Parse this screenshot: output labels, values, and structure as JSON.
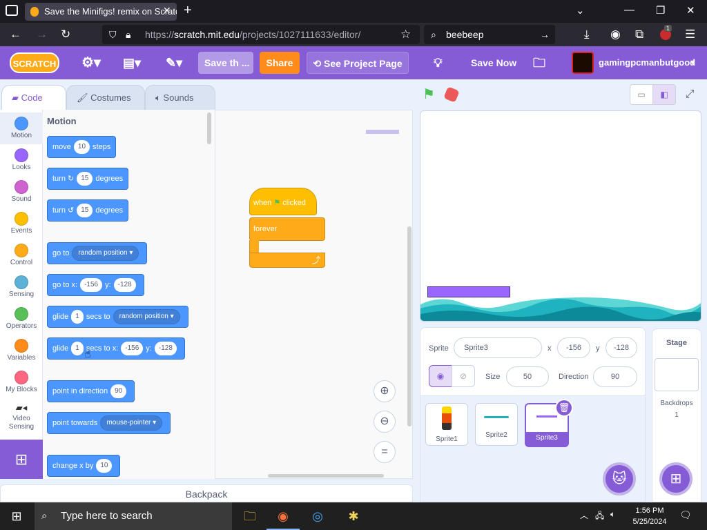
{
  "browser": {
    "tab_title": "Save the Minifigs! remix on Scratch",
    "url_prefix": "https://",
    "url_host": "scratch.mit.edu",
    "url_path": "/projects/1027111633/editor/",
    "search_value": "beebeep",
    "extension_badge": "1"
  },
  "menubar": {
    "logo": "SCRATCH",
    "title_field": "Save th ...",
    "share": "Share",
    "see_project": "See Project Page",
    "save_now": "Save Now",
    "username": "gamingpcmanbutgood",
    "colors": {
      "bar": "#855cd6",
      "share": "#ff8c1a"
    }
  },
  "editor_tabs": {
    "code": "Code",
    "costumes": "Costumes",
    "sounds": "Sounds"
  },
  "categories": [
    {
      "label": "Motion",
      "color": "#4c97ff"
    },
    {
      "label": "Looks",
      "color": "#9966ff"
    },
    {
      "label": "Sound",
      "color": "#cf63cf"
    },
    {
      "label": "Events",
      "color": "#ffbf00"
    },
    {
      "label": "Control",
      "color": "#ffab19"
    },
    {
      "label": "Sensing",
      "color": "#5cb1d6"
    },
    {
      "label": "Operators",
      "color": "#59c059"
    },
    {
      "label": "Variables",
      "color": "#ff8c1a"
    },
    {
      "label": "My Blocks",
      "color": "#ff6680"
    },
    {
      "label": "Video Sensing",
      "color": "#0fbd8c"
    }
  ],
  "palette": {
    "heading": "Motion",
    "move": {
      "a": "move",
      "v": "10",
      "b": "steps"
    },
    "turn_right": {
      "a": "turn",
      "v": "15",
      "b": "degrees"
    },
    "turn_left": {
      "a": "turn",
      "v": "15",
      "b": "degrees"
    },
    "goto": {
      "a": "go to",
      "d": "random position"
    },
    "goto_xy": {
      "a": "go to x:",
      "x": "-156",
      "b": "y:",
      "y": "-128"
    },
    "glide": {
      "a": "glide",
      "v": "1",
      "b": "secs to",
      "d": "random position"
    },
    "glide_xy": {
      "a": "glide",
      "v": "1",
      "b": "secs to x:",
      "x": "-156",
      "c": "y:",
      "y": "-128"
    },
    "point_dir": {
      "a": "point in direction",
      "v": "90"
    },
    "point_towards": {
      "a": "point towards",
      "d": "mouse-pointer"
    },
    "change_x": {
      "a": "change x by",
      "v": "10"
    }
  },
  "script": {
    "when": "when",
    "clicked": "clicked",
    "forever": "forever"
  },
  "backpack": "Backpack",
  "sprite_info": {
    "sprite_label": "Sprite",
    "sprite_name": "Sprite3",
    "x_label": "x",
    "x": "-156",
    "y_label": "y",
    "y": "-128",
    "size_label": "Size",
    "size": "50",
    "direction_label": "Direction",
    "direction": "90"
  },
  "sprites": [
    "Sprite1",
    "Sprite2",
    "Sprite3"
  ],
  "stage_panel": {
    "title": "Stage",
    "backdrops_label": "Backdrops",
    "backdrops_count": "1"
  },
  "taskbar": {
    "search_placeholder": "Type here to search",
    "time": "1:56 PM",
    "date": "5/25/2024"
  }
}
